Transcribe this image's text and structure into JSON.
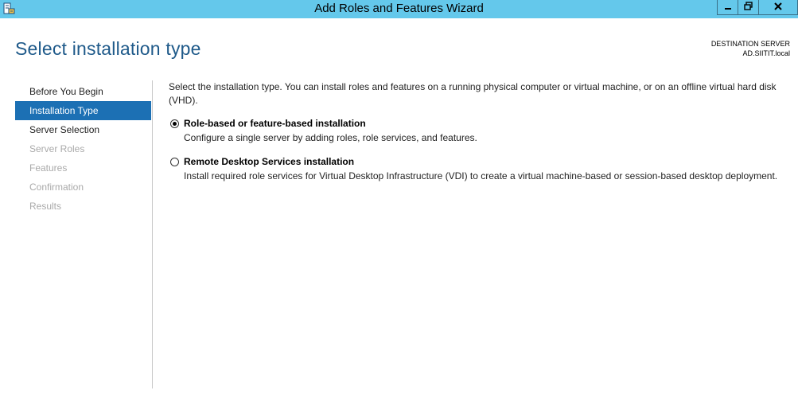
{
  "window": {
    "title": "Add Roles and Features Wizard",
    "app_icon": "server-manager-icon",
    "controls": {
      "minimize_icon": "minimize-icon",
      "restore_icon": "restore-icon",
      "close_icon": "close-icon"
    },
    "titlebar_color": "#64c8eb"
  },
  "header": {
    "page_title": "Select installation type",
    "destination_label": "DESTINATION SERVER",
    "destination_value": "AD.SIITIT.local"
  },
  "nav": {
    "items": [
      {
        "label": "Before You Begin",
        "state": "normal"
      },
      {
        "label": "Installation Type",
        "state": "active"
      },
      {
        "label": "Server Selection",
        "state": "normal"
      },
      {
        "label": "Server Roles",
        "state": "disabled"
      },
      {
        "label": "Features",
        "state": "disabled"
      },
      {
        "label": "Confirmation",
        "state": "disabled"
      },
      {
        "label": "Results",
        "state": "disabled"
      }
    ],
    "active_color": "#1c70b4"
  },
  "content": {
    "intro": "Select the installation type. You can install roles and features on a running physical computer or virtual machine, or on an offline virtual hard disk (VHD).",
    "options": [
      {
        "title": "Role-based or feature-based installation",
        "description": "Configure a single server by adding roles, role services, and features.",
        "selected": true
      },
      {
        "title": "Remote Desktop Services installation",
        "description": "Install required role services for Virtual Desktop Infrastructure (VDI) to create a virtual machine-based or session-based desktop deployment.",
        "selected": false
      }
    ]
  }
}
